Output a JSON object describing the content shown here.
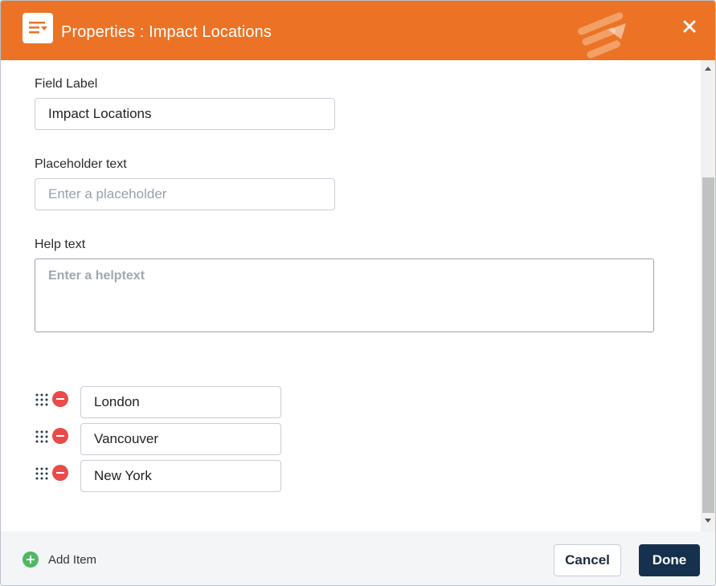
{
  "header": {
    "title": "Properties : Impact Locations",
    "icon": "list-filter-icon",
    "brand_icon": "brand-logo-icon",
    "close_icon": "close-icon",
    "color": "#ec7325"
  },
  "form": {
    "field_label": {
      "label": "Field Label",
      "value": "Impact Locations"
    },
    "placeholder_text": {
      "label": "Placeholder text",
      "placeholder": "Enter a placeholder"
    },
    "help_text": {
      "label": "Help text",
      "placeholder": "Enter a helptext"
    }
  },
  "options": [
    {
      "value": "London"
    },
    {
      "value": "Vancouver"
    },
    {
      "value": "New York"
    }
  ],
  "footer": {
    "add_item_label": "Add Item",
    "cancel_label": "Cancel",
    "done_label": "Done",
    "done_color": "#16314d",
    "add_color": "#4fb866",
    "remove_color": "#ea4a4a"
  }
}
